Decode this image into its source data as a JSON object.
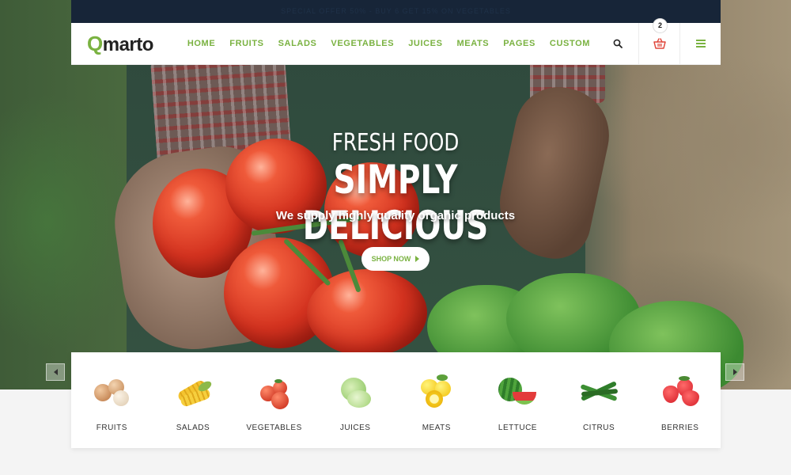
{
  "promo": {
    "text": "SPECIAL OFFER 50% - BUY 6 GET 15% ON VEGETABLES"
  },
  "header": {
    "logo_first": "Q",
    "logo_rest": "marto",
    "nav": [
      "HOME",
      "FRUITS",
      "SALADS",
      "VEGETABLES",
      "JUICES",
      "MEATS",
      "PAGES",
      "CUSTOM"
    ],
    "cart_count": "2"
  },
  "hero": {
    "line1": "FRESH FOOD",
    "line2": "SIMPLY DELICIOUS",
    "tagline": "We supply highly quality organic products",
    "button": "SHOP NOW"
  },
  "categories": [
    {
      "label": "FRUITS",
      "icon": "onion-icon"
    },
    {
      "label": "SALADS",
      "icon": "corn-icon"
    },
    {
      "label": "VEGETABLES",
      "icon": "tomato-icon"
    },
    {
      "label": "JUICES",
      "icon": "cabbage-icon"
    },
    {
      "label": "MEATS",
      "icon": "lemon-icon"
    },
    {
      "label": "LETTUCE",
      "icon": "watermelon-icon"
    },
    {
      "label": "CITRUS",
      "icon": "green-beans-icon"
    },
    {
      "label": "BERRIES",
      "icon": "strawberry-icon"
    }
  ],
  "colors": {
    "accent": "#7ab241",
    "promo_bg": "#172538"
  }
}
